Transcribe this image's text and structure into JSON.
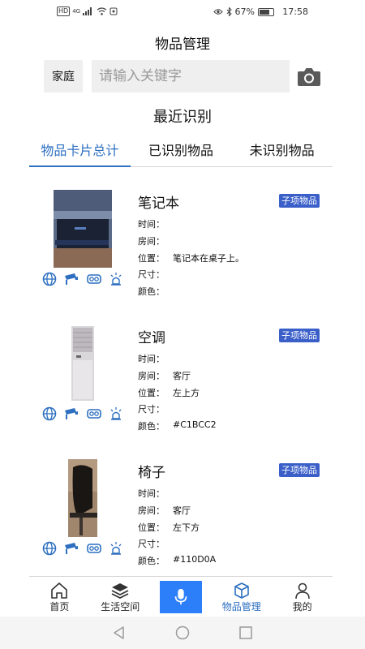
{
  "status_bar": {
    "left_badge_hd": "HD",
    "left_badge_4g": "4G",
    "battery_percent": "67%",
    "time": "17:58"
  },
  "header": {
    "title": "物品管理",
    "category": "家庭",
    "search_placeholder": "请输入关键字",
    "camera_icon": "camera-icon"
  },
  "section_title": "最近识别",
  "tabs": [
    {
      "label": "物品卡片总计",
      "active": true
    },
    {
      "label": "已识别物品",
      "active": false
    },
    {
      "label": "未识别物品",
      "active": false
    }
  ],
  "field_labels": {
    "time": "时间：",
    "room": "房间：",
    "position": "位置：",
    "size": "尺寸：",
    "color": "颜色："
  },
  "items": [
    {
      "name": "笔记本",
      "badge": "子项物品",
      "time": "",
      "room": "",
      "position": "笔记本在桌子上。",
      "size": "",
      "color": ""
    },
    {
      "name": "空调",
      "badge": "子项物品",
      "time": "",
      "room": "客厅",
      "position": "左上方",
      "size": "",
      "color": "#C1BCC2"
    },
    {
      "name": "椅子",
      "badge": "子项物品",
      "time": "",
      "room": "客厅",
      "position": "左下方",
      "size": "",
      "color": "#110D0A"
    }
  ],
  "item_icons": [
    "globe-icon",
    "security-camera-icon",
    "vr-headset-icon",
    "alarm-light-icon"
  ],
  "bottom_nav": [
    {
      "label": "首页",
      "icon": "home-icon"
    },
    {
      "label": "生活空间",
      "icon": "layers-icon"
    },
    {
      "label": "",
      "icon": "microphone-icon"
    },
    {
      "label": "物品管理",
      "icon": "cube-icon",
      "active": true
    },
    {
      "label": "我的",
      "icon": "user-icon"
    }
  ],
  "system_nav": [
    "back-icon",
    "home-circle-icon",
    "recents-icon"
  ],
  "colors": {
    "accent": "#2d6fc0",
    "badge_bg": "#3a5fc9",
    "mic_bg": "#2d7ff9",
    "input_bg": "#efefef"
  }
}
